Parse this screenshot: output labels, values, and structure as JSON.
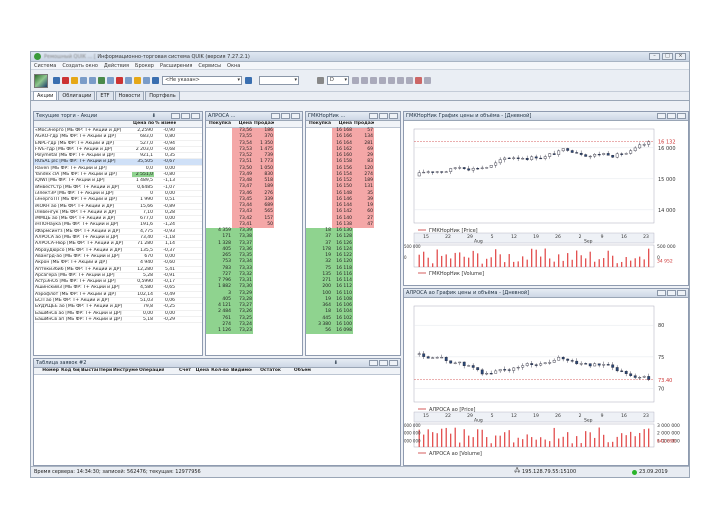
{
  "window": {
    "title": "Информационно-торговая система QUIK (версия 7.27.2.1)",
    "blurred_prefix": "Ремошный QUIK ... ["
  },
  "menu": [
    "Система",
    "Создать окно",
    "Действия",
    "Брокер",
    "Расширения",
    "Сервисы",
    "Окна"
  ],
  "toolbar": {
    "account_combo": "<Не указан>",
    "interval_combo": "D"
  },
  "tabs": [
    "Акции",
    "Облигации",
    "ETF",
    "Новости",
    "Портфель"
  ],
  "quotes": {
    "title": "Текущие торги - Акции",
    "headers": [
      "",
      "Цена послед",
      "% измен.закр"
    ],
    "rows": [
      [
        "«МосЭнерго [МБ ФР: Т+ Акции и ДР]",
        "2,2590",
        "-0,90"
      ],
      [
        "AGRO-гдр [МБ ФР: Т+ Акции и ДР]",
        "683,0",
        "0,80"
      ],
      [
        "ENPL-гдр [МБ ФР: Т+ Акции и ДР]",
        "527,0",
        "-0,94"
      ],
      [
        "FIVE-гдр [МБ ФР: Т+ Акции и ДР]",
        "2 203,0",
        "-0,68"
      ],
      [
        "Polymetal [МБ ФР: Т+ Акции и ДР]",
        "921,1",
        "0,35"
      ],
      [
        "RUSAL plc [МБ ФР: Т+ Акции и ДР]",
        "35,505",
        "-0,67"
      ],
      [
        "Raven [МБ ФР: Т+ Акции и ДР]",
        "0,0",
        "0,00"
      ],
      [
        "Yandex clA [МБ ФР: Т+ Акции и ДР]",
        "2 551,0",
        "-0,80"
      ],
      [
        "iQIWI [МБ ФР: Т+ Акции и ДР]",
        "1 489,5",
        "-1,13"
      ],
      [
        "iИнвестСтр [МБ ФР: Т+ Акции и ДР]",
        "0,6485",
        "-1,07"
      ],
      [
        "iЭлектЗР [МБ ФР: Т+ Акции и ДР]",
        "0",
        "0,00"
      ],
      [
        "iЭнергоТП [МБ ФР: Т+ Акции и ДР]",
        "1 990",
        "0,51"
      ],
      [
        "iКОКН ао [МБ ФР: Т+ Акции и ДР]",
        "15,66",
        "-0,89"
      ],
      [
        "iЛевенгук [МБ ФР: Т+ Акции и ДР]",
        "7,10",
        "0,28"
      ],
      [
        "iММЦБ ао [МБ ФР: Т+ Акции и ДР]",
        "677,0",
        "0,00"
      ],
      [
        "iНПОНаука [МБ ФР: Т+ Акции и ДР]",
        "191,6",
        "-1,24"
      ],
      [
        "iФармсинтз [МБ ФР: Т+ Акции и ДР]",
        "4,775",
        "-0,93"
      ],
      [
        "АЛРОСА ао [МБ ФР: Т+ Акции и ДР]",
        "73,40",
        "-1,18"
      ],
      [
        "АЛРОСА-Нюр [МБ ФР: Т+ Акции и ДР]",
        "71 280",
        "1,14"
      ],
      [
        "АбрауДюрсо [МБ ФР: Т+ Акции и ДР]",
        "135,5",
        "-0,37"
      ],
      [
        "Авангрд-ао [МБ ФР: Т+ Акции и ДР]",
        "670",
        "0,00"
      ],
      [
        "Акрон [МБ ФР: Т+ Акции и ДР]",
        "4 940",
        "-0,60"
      ],
      [
        "АптекиЗ6и6 [МБ ФР: Т+ Акции и ДР]",
        "12,280",
        "5,41"
      ],
      [
        "Арсагера [МБ ФР: Т+ Акции и ДР]",
        "5,28",
        "-0,91"
      ],
      [
        "АстрЭнСб [МБ ФР: Т+ Акции и ДР]",
        "0,5990",
        "-0,17"
      ],
      [
        "Ашинский3 [МБ ФР: Т+ Акции и ДР]",
        "4,580",
        "-0,65"
      ],
      [
        "Аэрофлот [МБ ФР: Т+ Акции и ДР]",
        "102,14",
        "-0,49"
      ],
      [
        "БСП ао [МБ ФР: Т+ Акции и ДР]",
        "51,03",
        "0,06"
      ],
      [
        "БУДУЩЕЕ ао [МБ ФР: Т+ Акции и ДР]",
        "79,8",
        "-0,25"
      ],
      [
        "БашИнСв ао [МБ ФР: Т+ Акции и ДР]",
        "0,00",
        "0,00"
      ],
      [
        "БашИнСв ап [МБ ФР: Т+ Акции и ДР]",
        "5,18",
        "-0,29"
      ]
    ]
  },
  "glass_alrosa": {
    "title": "АЛРОСА ...",
    "headers": [
      "Покупка",
      "Цена",
      "Продажа"
    ],
    "sell": [
      [
        "",
        "73,56",
        "186"
      ],
      [
        "",
        "73,55",
        "370"
      ],
      [
        "",
        "73,54",
        "1 350"
      ],
      [
        "",
        "73,53",
        "1 475"
      ],
      [
        "",
        "73,52",
        "739"
      ],
      [
        "",
        "73,51",
        "1 773"
      ],
      [
        "",
        "73,50",
        "1 050"
      ],
      [
        "",
        "73,49",
        "830"
      ],
      [
        "",
        "73,48",
        "518"
      ],
      [
        "",
        "73,47",
        "189"
      ],
      [
        "",
        "73,46",
        "276"
      ],
      [
        "",
        "73,45",
        "339"
      ],
      [
        "",
        "73,44",
        "689"
      ],
      [
        "",
        "73,43",
        "565"
      ],
      [
        "",
        "73,42",
        "157"
      ],
      [
        "",
        "73,41",
        "50"
      ]
    ],
    "buy": [
      [
        "4 359",
        "73,39",
        ""
      ],
      [
        "171",
        "73,38",
        ""
      ],
      [
        "1 328",
        "73,37",
        ""
      ],
      [
        "405",
        "73,36",
        ""
      ],
      [
        "265",
        "73,35",
        ""
      ],
      [
        "753",
        "73,34",
        ""
      ],
      [
        "783",
        "73,33",
        ""
      ],
      [
        "727",
        "73,32",
        ""
      ],
      [
        "7 796",
        "73,31",
        ""
      ],
      [
        "1 882",
        "73,30",
        ""
      ],
      [
        "3",
        "73,29",
        ""
      ],
      [
        "405",
        "73,28",
        ""
      ],
      [
        "4 121",
        "73,27",
        ""
      ],
      [
        "2 484",
        "73,26",
        ""
      ],
      [
        "761",
        "73,25",
        ""
      ],
      [
        "274",
        "73,24",
        ""
      ],
      [
        "1 126",
        "73,23",
        ""
      ]
    ]
  },
  "glass_gmk": {
    "title": "ГМКНорНик ...",
    "headers": [
      "Покупка",
      "Цена",
      "Продажа"
    ],
    "sell": [
      [
        "",
        "16 168",
        "57"
      ],
      [
        "",
        "16 166",
        "134"
      ],
      [
        "",
        "16 164",
        "281"
      ],
      [
        "",
        "16 162",
        "69"
      ],
      [
        "",
        "16 160",
        "29"
      ],
      [
        "",
        "16 158",
        "83"
      ],
      [
        "",
        "16 156",
        "120"
      ],
      [
        "",
        "16 154",
        "274"
      ],
      [
        "",
        "16 152",
        "189"
      ],
      [
        "",
        "16 150",
        "131"
      ],
      [
        "",
        "16 148",
        "35"
      ],
      [
        "",
        "16 146",
        "39"
      ],
      [
        "",
        "16 144",
        "19"
      ],
      [
        "",
        "16 142",
        "60"
      ],
      [
        "",
        "16 140",
        "27"
      ],
      [
        "",
        "16 138",
        "47"
      ]
    ],
    "buy": [
      [
        "18",
        "16 130",
        ""
      ],
      [
        "37",
        "16 128",
        ""
      ],
      [
        "37",
        "16 126",
        ""
      ],
      [
        "178",
        "16 124",
        ""
      ],
      [
        "19",
        "16 122",
        ""
      ],
      [
        "32",
        "16 120",
        ""
      ],
      [
        "75",
        "16 118",
        ""
      ],
      [
        "135",
        "16 116",
        ""
      ],
      [
        "271",
        "16 114",
        ""
      ],
      [
        "200",
        "16 112",
        ""
      ],
      [
        "100",
        "16 110",
        ""
      ],
      [
        "19",
        "16 108",
        ""
      ],
      [
        "364",
        "16 106",
        ""
      ],
      [
        "18",
        "16 104",
        ""
      ],
      [
        "445",
        "16 102",
        ""
      ],
      [
        "3 380",
        "16 100",
        ""
      ],
      [
        "56",
        "16 098",
        ""
      ]
    ]
  },
  "chart_gmk": {
    "title": "ГМКНорНик График цены и объёма - [Дневной]",
    "price_legend": "ГМКНорНик [Price]",
    "volume_legend": "ГМКНорНик [Volume]",
    "price_ticks": [
      "16 000",
      "15 000",
      "14 000"
    ],
    "price_label": "16 132",
    "volume_ticks": [
      "500 000",
      "0"
    ],
    "volume_label": "34 952",
    "vol_left_ticks": [
      "500 000",
      "0"
    ],
    "x_ticks": [
      "15",
      "22",
      "29",
      "5",
      "12",
      "19",
      "26",
      "2",
      "9",
      "16",
      "23"
    ],
    "x_months": [
      "Aug",
      "Sep"
    ]
  },
  "chart_alrosa": {
    "title": "АЛРОСА ао График цены и объёма - [Дневной]",
    "price_legend": "АЛРОСА ао [Price]",
    "volume_legend": "АЛРОСА ао [Volume]",
    "price_ticks": [
      "80",
      "75",
      "70"
    ],
    "price_label": "73.40",
    "volume_ticks": [
      "3 000 000",
      "2 000 000",
      "1 000 000"
    ],
    "volume_label": "642 890",
    "vol_left_ticks": [
      "000 000",
      "000 000",
      "000 000"
    ],
    "x_ticks": [
      "15",
      "22",
      "29",
      "5",
      "12",
      "19",
      "26",
      "2",
      "9",
      "16",
      "23"
    ],
    "x_months": [
      "Aug",
      "Sep"
    ]
  },
  "orders": {
    "title": "Таблица заявок #2",
    "headers": [
      "Номер",
      "Код бирж",
      "Выставл",
      "Период",
      "Инструмент",
      "Операция",
      "Счет",
      "Цена",
      "Кол-во",
      "Видимое",
      "Остаток",
      "Объем"
    ]
  },
  "status": {
    "left": "Время сервера: 14:34:30; записей: 562476; текущая: 12977956",
    "ip": "195.128.79.55:15100",
    "date": "23.09.2019"
  },
  "colors": {
    "sell": "#f4a7a7",
    "buy": "#8fd38f",
    "candle_up": "#ffffff",
    "candle_down": "#2a4a7a",
    "volume": "#e04040",
    "price_line": "#cc3333"
  }
}
